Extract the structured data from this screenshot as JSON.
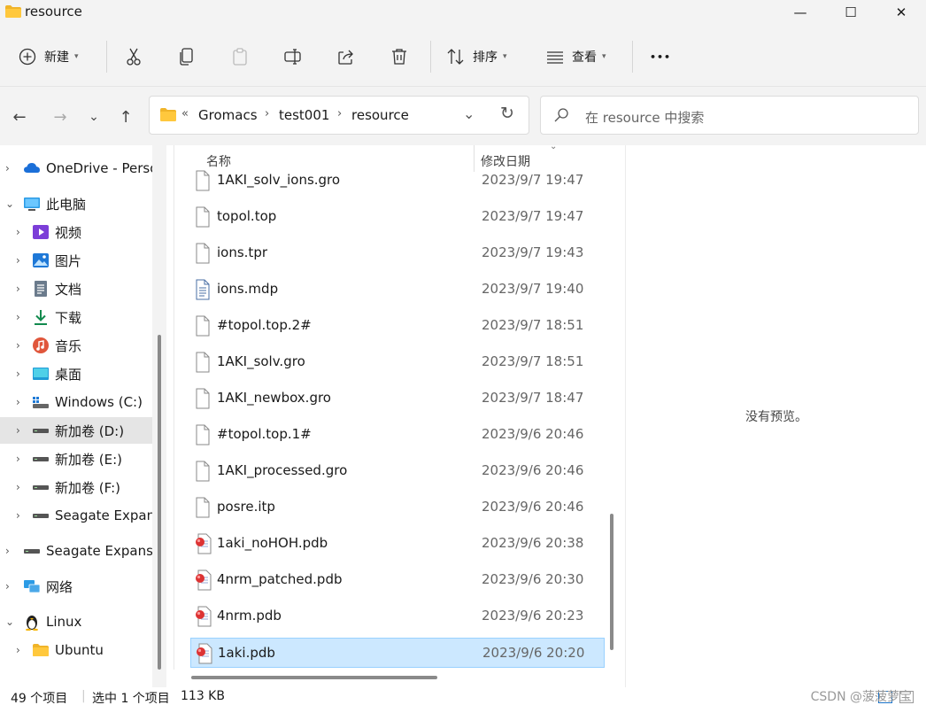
{
  "window": {
    "title": "resource",
    "minimize_glyph": "—",
    "maximize_glyph": "☐",
    "close_glyph": "✕"
  },
  "toolbar": {
    "new_label": "新建",
    "sort_label": "排序",
    "view_label": "查看",
    "more_glyph": "•••"
  },
  "nav": {
    "back_glyph": "←",
    "forward_glyph": "→",
    "recent_glyph": "⌄",
    "up_glyph": "↑",
    "breadcrumb_overflow": "«",
    "breadcrumb": [
      "Gromacs",
      "test001",
      "resource"
    ],
    "dropdown_glyph": "⌄",
    "refresh_glyph": "↻"
  },
  "search": {
    "placeholder": "在 resource 中搜索"
  },
  "sidebar": {
    "items": [
      {
        "label": "OneDrive - Personal",
        "icon": "cloud-icon",
        "expanded": false
      },
      {
        "label": "此电脑",
        "icon": "computer-icon",
        "expanded": true
      },
      {
        "label": "视频",
        "icon": "video-icon",
        "expanded": false
      },
      {
        "label": "图片",
        "icon": "picture-icon",
        "expanded": false
      },
      {
        "label": "文档",
        "icon": "document-icon",
        "expanded": false
      },
      {
        "label": "下载",
        "icon": "download-icon",
        "expanded": false
      },
      {
        "label": "音乐",
        "icon": "music-icon",
        "expanded": false
      },
      {
        "label": "桌面",
        "icon": "desktop-icon",
        "expanded": false
      },
      {
        "label": "Windows (C:)",
        "icon": "windows-drive-icon",
        "expanded": false
      },
      {
        "label": "新加卷 (D:)",
        "icon": "drive-icon",
        "expanded": false,
        "selected": true
      },
      {
        "label": "新加卷 (E:)",
        "icon": "drive-icon",
        "expanded": false
      },
      {
        "label": "新加卷 (F:)",
        "icon": "drive-icon",
        "expanded": false
      },
      {
        "label": "Seagate Expansion Drive",
        "icon": "drive-icon",
        "expanded": false
      },
      {
        "label": "Seagate Expansion Drive",
        "icon": "drive-icon",
        "expanded": false
      },
      {
        "label": "网络",
        "icon": "network-icon",
        "expanded": false
      },
      {
        "label": "Linux",
        "icon": "linux-penguin-icon",
        "expanded": true
      },
      {
        "label": "Ubuntu",
        "icon": "folder-icon",
        "expanded": false
      }
    ]
  },
  "filelist": {
    "columns": {
      "name": "名称",
      "modified": "修改日期"
    },
    "rows": [
      {
        "name": "1AKI_solv_ions.gro",
        "date": "2023/9/7 19:47",
        "icon": "file-icon"
      },
      {
        "name": "topol.top",
        "date": "2023/9/7 19:47",
        "icon": "file-icon"
      },
      {
        "name": "ions.tpr",
        "date": "2023/9/7 19:43",
        "icon": "file-icon"
      },
      {
        "name": "ions.mdp",
        "date": "2023/9/7 19:40",
        "icon": "text-file-icon"
      },
      {
        "name": "#topol.top.2#",
        "date": "2023/9/7 18:51",
        "icon": "file-icon"
      },
      {
        "name": "1AKI_solv.gro",
        "date": "2023/9/7 18:51",
        "icon": "file-icon"
      },
      {
        "name": "1AKI_newbox.gro",
        "date": "2023/9/7 18:47",
        "icon": "file-icon"
      },
      {
        "name": "#topol.top.1#",
        "date": "2023/9/6 20:46",
        "icon": "file-icon"
      },
      {
        "name": "1AKI_processed.gro",
        "date": "2023/9/6 20:46",
        "icon": "file-icon"
      },
      {
        "name": "posre.itp",
        "date": "2023/9/6 20:46",
        "icon": "file-icon"
      },
      {
        "name": "1aki_noHOH.pdb",
        "date": "2023/9/6 20:38",
        "icon": "pdb-file-icon"
      },
      {
        "name": "4nrm_patched.pdb",
        "date": "2023/9/6 20:30",
        "icon": "pdb-file-icon"
      },
      {
        "name": "4nrm.pdb",
        "date": "2023/9/6 20:23",
        "icon": "pdb-file-icon"
      },
      {
        "name": "1aki.pdb",
        "date": "2023/9/6 20:20",
        "icon": "pdb-file-icon",
        "selected": true
      }
    ]
  },
  "preview": {
    "text": "没有预览。"
  },
  "status": {
    "count": "49 个项目",
    "selection": "选中 1 个项目",
    "size": "113 KB",
    "watermark": "CSDN @菠菠萝宝"
  }
}
